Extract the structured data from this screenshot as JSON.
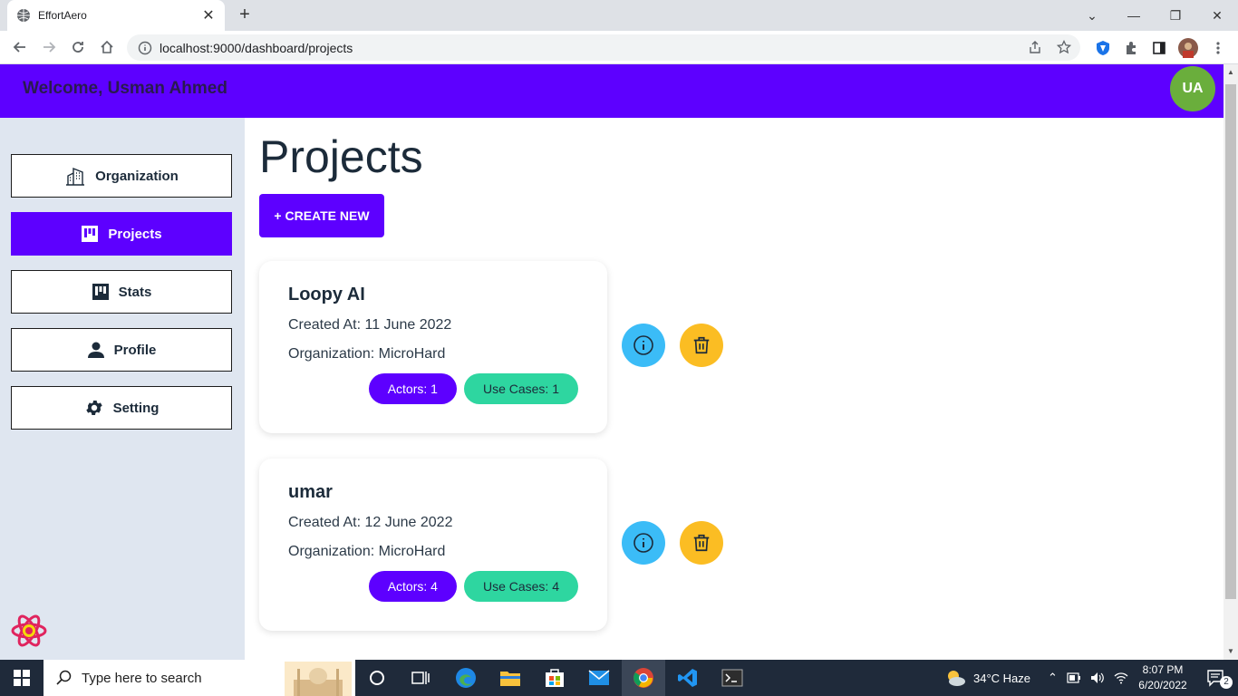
{
  "browser": {
    "tab_title": "EffortAero",
    "url": "localhost:9000/dashboard/projects"
  },
  "header": {
    "welcome": "Welcome, Usman Ahmed",
    "avatar_initials": "UA",
    "accent_color": "#5d00ff"
  },
  "sidebar": {
    "items": [
      {
        "label": "Organization",
        "icon": "building-icon"
      },
      {
        "label": "Projects",
        "icon": "board-icon",
        "active": true
      },
      {
        "label": "Stats",
        "icon": "board-icon"
      },
      {
        "label": "Profile",
        "icon": "person-icon"
      },
      {
        "label": "Setting",
        "icon": "gear-icon"
      }
    ]
  },
  "main": {
    "title": "Projects",
    "create_label": "+ CREATE NEW",
    "projects": [
      {
        "name": "Loopy AI",
        "created": "Created At: 11 June 2022",
        "organization": "Organization: MicroHard",
        "actors": "Actors: 1",
        "use_cases": "Use Cases: 1"
      },
      {
        "name": "umar",
        "created": "Created At: 12 June 2022",
        "organization": "Organization: MicroHard",
        "actors": "Actors: 4",
        "use_cases": "Use Cases: 4"
      }
    ]
  },
  "taskbar": {
    "search_placeholder": "Type here to search",
    "weather": "34°C  Haze",
    "time": "8:07 PM",
    "date": "6/20/2022",
    "notifications": "2"
  }
}
